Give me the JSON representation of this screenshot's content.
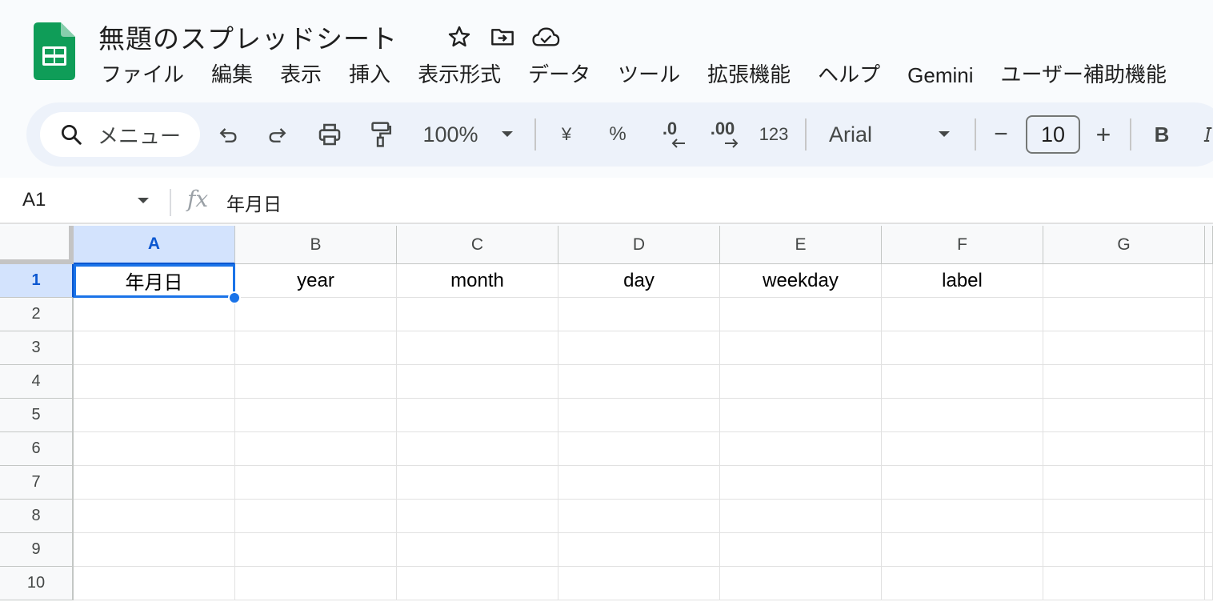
{
  "doc": {
    "title": "無題のスプレッドシート"
  },
  "menu": [
    "ファイル",
    "編集",
    "表示",
    "挿入",
    "表示形式",
    "データ",
    "ツール",
    "拡張機能",
    "ヘルプ",
    "Gemini",
    "ユーザー補助機能"
  ],
  "toolbar": {
    "search_label": "メニュー",
    "zoom": "100%",
    "currency": "¥",
    "percent": "%",
    "dec_decrease": ".0",
    "dec_increase": ".00",
    "number_format": "123",
    "font": "Arial",
    "minus": "−",
    "font_size": "10",
    "plus": "+",
    "bold": "B"
  },
  "formula_bar": {
    "name_box": "A1",
    "fx": "fx",
    "value": "年月日"
  },
  "grid": {
    "columns": [
      "A",
      "B",
      "C",
      "D",
      "E",
      "F",
      "G"
    ],
    "rows": [
      "1",
      "2",
      "3",
      "4",
      "5",
      "6",
      "7",
      "8",
      "9",
      "10"
    ],
    "row1": [
      "年月日",
      "year",
      "month",
      "day",
      "weekday",
      "label",
      ""
    ],
    "active_cell": "A1"
  },
  "colors": {
    "brand_green": "#0f9d58",
    "selection_blue": "#1a73e8",
    "header_selected": "#d3e3fd"
  }
}
